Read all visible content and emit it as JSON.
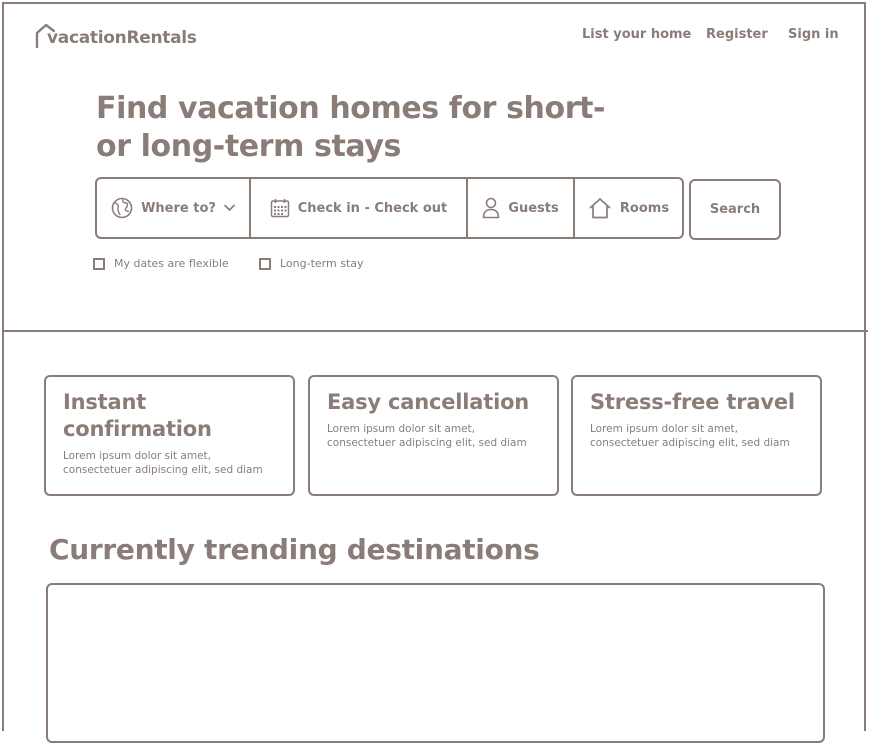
{
  "brand": {
    "name": "vacationRentals"
  },
  "nav": {
    "list_home": "List your home",
    "register": "Register",
    "sign_in": "Sign in"
  },
  "hero": {
    "title": "Find vacation homes for short-or long-term stays"
  },
  "search": {
    "where": "Where to?",
    "dates": "Check in - Check out",
    "guests": "Guests",
    "rooms": "Rooms",
    "button": "Search"
  },
  "options": {
    "flexible": "My dates are flexible",
    "long_term": "Long-term stay"
  },
  "features": [
    {
      "title": "Instant confirmation",
      "text": "Lorem ipsum dolor sit amet, consectetuer adipiscing elit, sed diam"
    },
    {
      "title": "Easy cancellation",
      "text": "Lorem ipsum dolor sit amet, consectetuer adipiscing elit, sed diam"
    },
    {
      "title": "Stress-free travel",
      "text": "Lorem ipsum dolor sit amet, consectetuer adipiscing elit, sed diam"
    }
  ],
  "trending": {
    "title": "Currently trending destinations"
  },
  "colors": {
    "ink": "#8a7d78",
    "background": "#ffffff"
  }
}
